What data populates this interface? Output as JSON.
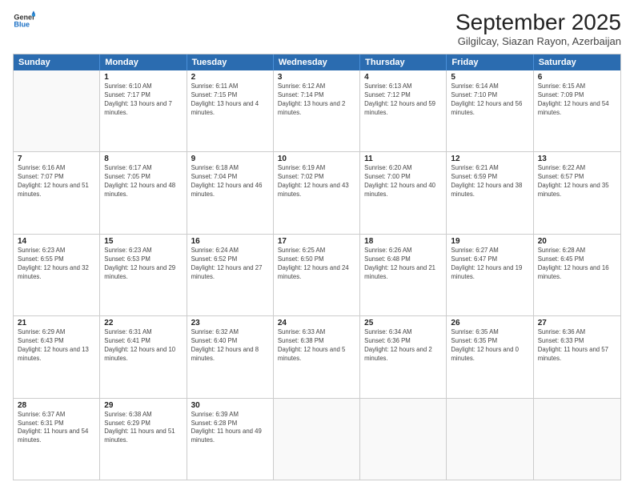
{
  "header": {
    "logo_line1": "General",
    "logo_line2": "Blue",
    "month": "September 2025",
    "location": "Gilgilcay, Siazan Rayon, Azerbaijan"
  },
  "weekdays": [
    "Sunday",
    "Monday",
    "Tuesday",
    "Wednesday",
    "Thursday",
    "Friday",
    "Saturday"
  ],
  "weeks": [
    [
      {
        "date": "",
        "sunrise": "",
        "sunset": "",
        "daylight": ""
      },
      {
        "date": "1",
        "sunrise": "Sunrise: 6:10 AM",
        "sunset": "Sunset: 7:17 PM",
        "daylight": "Daylight: 13 hours and 7 minutes."
      },
      {
        "date": "2",
        "sunrise": "Sunrise: 6:11 AM",
        "sunset": "Sunset: 7:15 PM",
        "daylight": "Daylight: 13 hours and 4 minutes."
      },
      {
        "date": "3",
        "sunrise": "Sunrise: 6:12 AM",
        "sunset": "Sunset: 7:14 PM",
        "daylight": "Daylight: 13 hours and 2 minutes."
      },
      {
        "date": "4",
        "sunrise": "Sunrise: 6:13 AM",
        "sunset": "Sunset: 7:12 PM",
        "daylight": "Daylight: 12 hours and 59 minutes."
      },
      {
        "date": "5",
        "sunrise": "Sunrise: 6:14 AM",
        "sunset": "Sunset: 7:10 PM",
        "daylight": "Daylight: 12 hours and 56 minutes."
      },
      {
        "date": "6",
        "sunrise": "Sunrise: 6:15 AM",
        "sunset": "Sunset: 7:09 PM",
        "daylight": "Daylight: 12 hours and 54 minutes."
      }
    ],
    [
      {
        "date": "7",
        "sunrise": "Sunrise: 6:16 AM",
        "sunset": "Sunset: 7:07 PM",
        "daylight": "Daylight: 12 hours and 51 minutes."
      },
      {
        "date": "8",
        "sunrise": "Sunrise: 6:17 AM",
        "sunset": "Sunset: 7:05 PM",
        "daylight": "Daylight: 12 hours and 48 minutes."
      },
      {
        "date": "9",
        "sunrise": "Sunrise: 6:18 AM",
        "sunset": "Sunset: 7:04 PM",
        "daylight": "Daylight: 12 hours and 46 minutes."
      },
      {
        "date": "10",
        "sunrise": "Sunrise: 6:19 AM",
        "sunset": "Sunset: 7:02 PM",
        "daylight": "Daylight: 12 hours and 43 minutes."
      },
      {
        "date": "11",
        "sunrise": "Sunrise: 6:20 AM",
        "sunset": "Sunset: 7:00 PM",
        "daylight": "Daylight: 12 hours and 40 minutes."
      },
      {
        "date": "12",
        "sunrise": "Sunrise: 6:21 AM",
        "sunset": "Sunset: 6:59 PM",
        "daylight": "Daylight: 12 hours and 38 minutes."
      },
      {
        "date": "13",
        "sunrise": "Sunrise: 6:22 AM",
        "sunset": "Sunset: 6:57 PM",
        "daylight": "Daylight: 12 hours and 35 minutes."
      }
    ],
    [
      {
        "date": "14",
        "sunrise": "Sunrise: 6:23 AM",
        "sunset": "Sunset: 6:55 PM",
        "daylight": "Daylight: 12 hours and 32 minutes."
      },
      {
        "date": "15",
        "sunrise": "Sunrise: 6:23 AM",
        "sunset": "Sunset: 6:53 PM",
        "daylight": "Daylight: 12 hours and 29 minutes."
      },
      {
        "date": "16",
        "sunrise": "Sunrise: 6:24 AM",
        "sunset": "Sunset: 6:52 PM",
        "daylight": "Daylight: 12 hours and 27 minutes."
      },
      {
        "date": "17",
        "sunrise": "Sunrise: 6:25 AM",
        "sunset": "Sunset: 6:50 PM",
        "daylight": "Daylight: 12 hours and 24 minutes."
      },
      {
        "date": "18",
        "sunrise": "Sunrise: 6:26 AM",
        "sunset": "Sunset: 6:48 PM",
        "daylight": "Daylight: 12 hours and 21 minutes."
      },
      {
        "date": "19",
        "sunrise": "Sunrise: 6:27 AM",
        "sunset": "Sunset: 6:47 PM",
        "daylight": "Daylight: 12 hours and 19 minutes."
      },
      {
        "date": "20",
        "sunrise": "Sunrise: 6:28 AM",
        "sunset": "Sunset: 6:45 PM",
        "daylight": "Daylight: 12 hours and 16 minutes."
      }
    ],
    [
      {
        "date": "21",
        "sunrise": "Sunrise: 6:29 AM",
        "sunset": "Sunset: 6:43 PM",
        "daylight": "Daylight: 12 hours and 13 minutes."
      },
      {
        "date": "22",
        "sunrise": "Sunrise: 6:31 AM",
        "sunset": "Sunset: 6:41 PM",
        "daylight": "Daylight: 12 hours and 10 minutes."
      },
      {
        "date": "23",
        "sunrise": "Sunrise: 6:32 AM",
        "sunset": "Sunset: 6:40 PM",
        "daylight": "Daylight: 12 hours and 8 minutes."
      },
      {
        "date": "24",
        "sunrise": "Sunrise: 6:33 AM",
        "sunset": "Sunset: 6:38 PM",
        "daylight": "Daylight: 12 hours and 5 minutes."
      },
      {
        "date": "25",
        "sunrise": "Sunrise: 6:34 AM",
        "sunset": "Sunset: 6:36 PM",
        "daylight": "Daylight: 12 hours and 2 minutes."
      },
      {
        "date": "26",
        "sunrise": "Sunrise: 6:35 AM",
        "sunset": "Sunset: 6:35 PM",
        "daylight": "Daylight: 12 hours and 0 minutes."
      },
      {
        "date": "27",
        "sunrise": "Sunrise: 6:36 AM",
        "sunset": "Sunset: 6:33 PM",
        "daylight": "Daylight: 11 hours and 57 minutes."
      }
    ],
    [
      {
        "date": "28",
        "sunrise": "Sunrise: 6:37 AM",
        "sunset": "Sunset: 6:31 PM",
        "daylight": "Daylight: 11 hours and 54 minutes."
      },
      {
        "date": "29",
        "sunrise": "Sunrise: 6:38 AM",
        "sunset": "Sunset: 6:29 PM",
        "daylight": "Daylight: 11 hours and 51 minutes."
      },
      {
        "date": "30",
        "sunrise": "Sunrise: 6:39 AM",
        "sunset": "Sunset: 6:28 PM",
        "daylight": "Daylight: 11 hours and 49 minutes."
      },
      {
        "date": "",
        "sunrise": "",
        "sunset": "",
        "daylight": ""
      },
      {
        "date": "",
        "sunrise": "",
        "sunset": "",
        "daylight": ""
      },
      {
        "date": "",
        "sunrise": "",
        "sunset": "",
        "daylight": ""
      },
      {
        "date": "",
        "sunrise": "",
        "sunset": "",
        "daylight": ""
      }
    ]
  ]
}
